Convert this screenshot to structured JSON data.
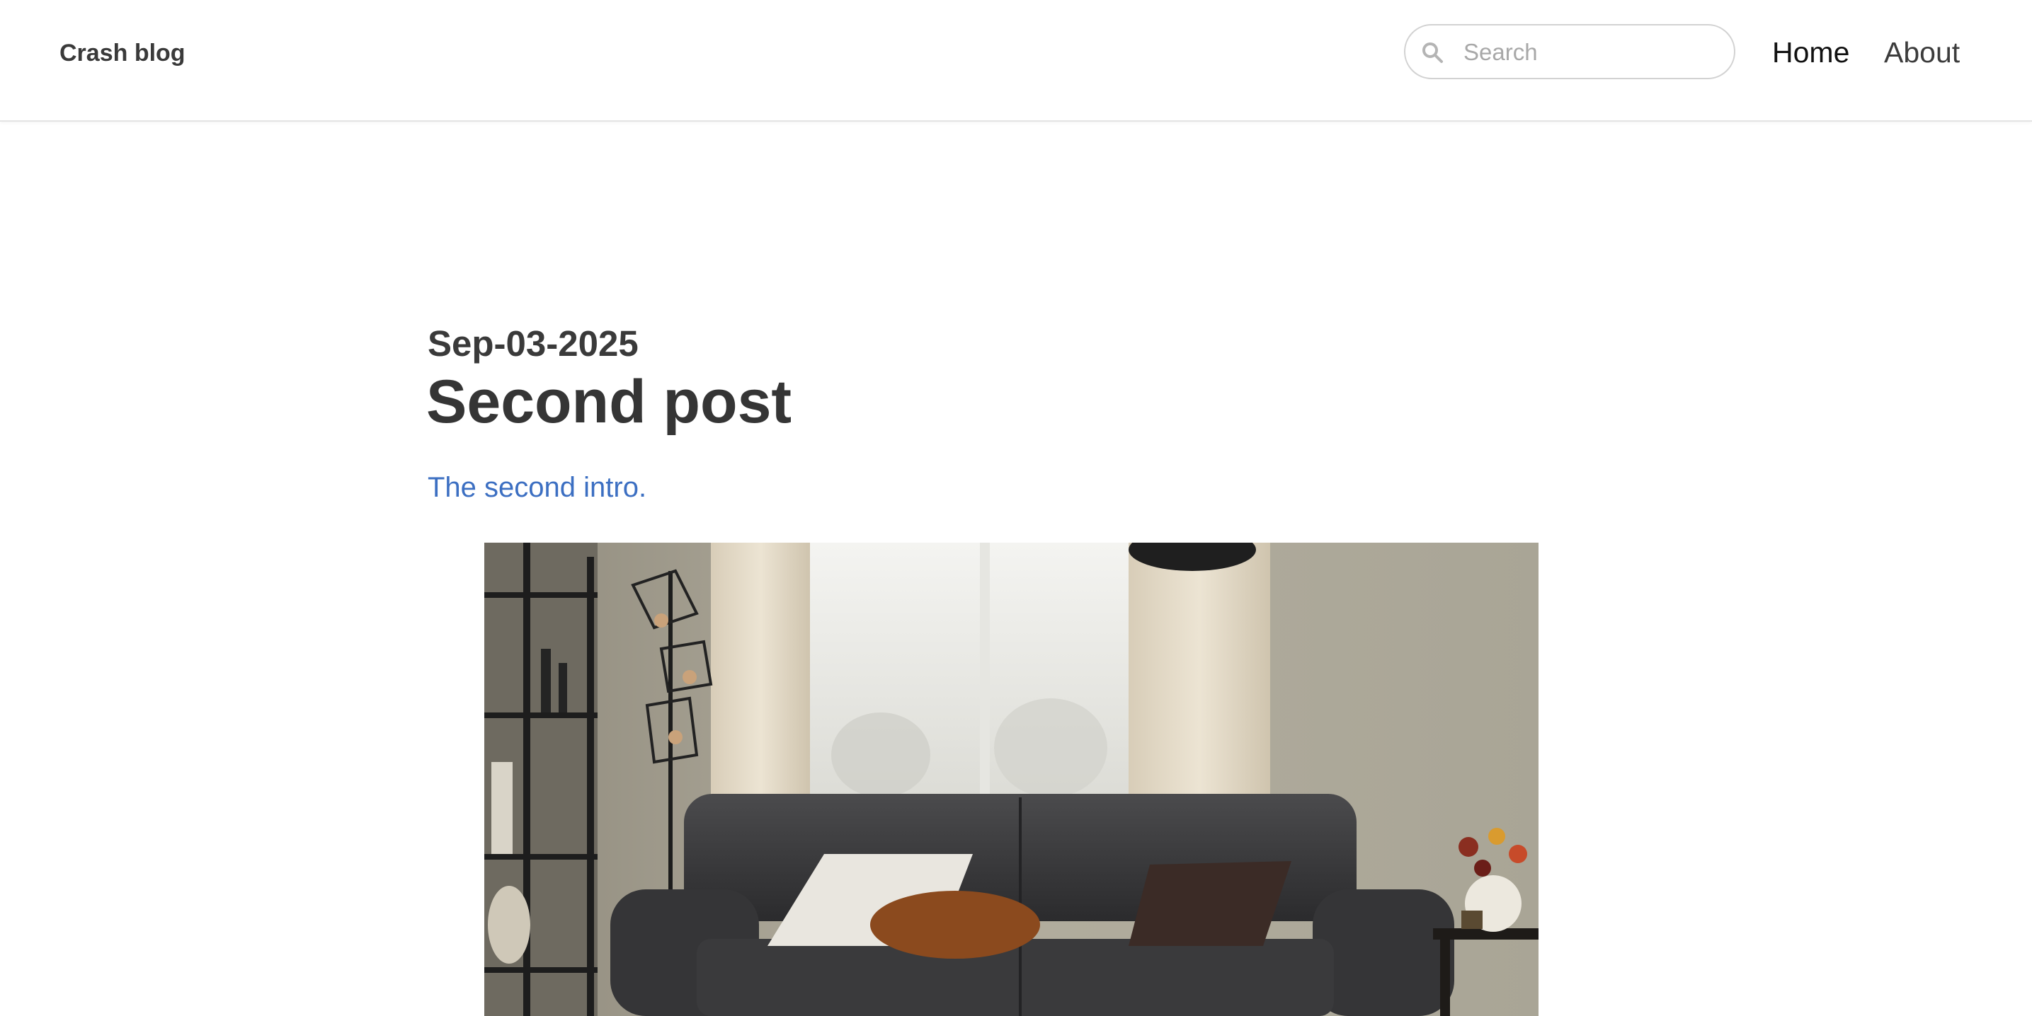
{
  "site": {
    "brand": "Crash blog"
  },
  "search": {
    "placeholder": "Search",
    "value": ""
  },
  "nav": {
    "home_label": "Home",
    "about_label": "About"
  },
  "post": {
    "date": "Sep-03-2025",
    "title": "Second post",
    "intro": "The second intro."
  },
  "colors": {
    "intro_link": "#3c6fc2",
    "text_dark": "#353535"
  },
  "icons": {
    "search": "search-icon"
  }
}
